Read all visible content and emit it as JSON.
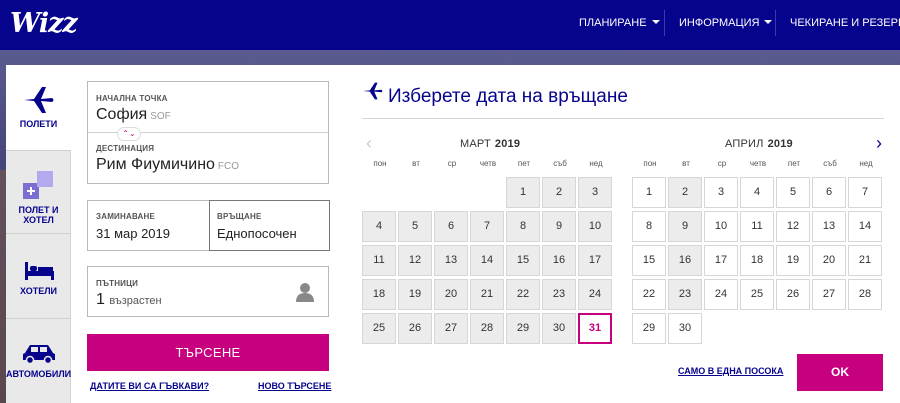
{
  "header": {
    "logo": "Wizz",
    "nav": [
      {
        "label": "ПЛАНИРАНЕ"
      },
      {
        "label": "ИНФОРМАЦИЯ"
      },
      {
        "label": "ЧЕКИРАНЕ И РЕЗЕРВАЦ"
      }
    ]
  },
  "tabs": [
    {
      "label": "ПОЛЕТИ",
      "icon": "plane-icon"
    },
    {
      "label": "ПОЛЕТ И ХОТЕЛ",
      "icon": "flight-hotel-icon"
    },
    {
      "label": "ХОТЕЛИ",
      "icon": "bed-icon"
    },
    {
      "label": "АВТОМОБИЛИ",
      "icon": "car-icon"
    }
  ],
  "form": {
    "origin": {
      "label": "НАЧАЛНА ТОЧКА",
      "city": "София",
      "code": "SOF"
    },
    "destination": {
      "label": "ДЕСТИНАЦИЯ",
      "city": "Рим Фиумичино",
      "code": "FCO"
    },
    "departure": {
      "label": "ЗАМИНАВАНЕ",
      "value": "31 мар 2019"
    },
    "return": {
      "label": "ВРЪЩАНЕ",
      "value": "Еднопосочен"
    },
    "passengers": {
      "label": "ПЪТНИЦИ",
      "count": "1",
      "type": "възрастен"
    },
    "search_label": "ТЪРСЕНЕ",
    "links": {
      "bored": "ДАТИТЕ ВИ СА ГЪВКАВИ?",
      "new_search": "НОВО ТЪРСЕНЕ"
    }
  },
  "calendar": {
    "title": "Изберете дата на връщане",
    "weekdays": [
      "пон",
      "вт",
      "ср",
      "четв",
      "пет",
      "съб",
      "нед"
    ],
    "months": [
      {
        "name": "МАРТ",
        "year": "2019",
        "offset": 4,
        "days": [
          "1",
          "2",
          "3",
          "4",
          "5",
          "6",
          "7",
          "8",
          "9",
          "10",
          "11",
          "12",
          "13",
          "14",
          "15",
          "16",
          "17",
          "18",
          "19",
          "20",
          "21",
          "22",
          "23",
          "24",
          "25",
          "26",
          "27",
          "28",
          "29",
          "30",
          "31"
        ],
        "selected": "31"
      },
      {
        "name": "АПРИЛ",
        "year": "2019",
        "offset": 0,
        "days": [
          "1",
          "2",
          "3",
          "4",
          "5",
          "6",
          "7",
          "8",
          "9",
          "10",
          "11",
          "12",
          "13",
          "14",
          "15",
          "16",
          "17",
          "18",
          "19",
          "20",
          "21",
          "22",
          "23",
          "24",
          "25",
          "26",
          "27",
          "28",
          "29",
          "30"
        ],
        "greyed": [
          "2",
          "9",
          "16",
          "23"
        ]
      }
    ],
    "one_way_label": "САМО В ЕДНА ПОСОКА",
    "ok_label": "OK"
  },
  "colors": {
    "brand_navy": "#06038d",
    "accent_magenta": "#c6007e"
  }
}
